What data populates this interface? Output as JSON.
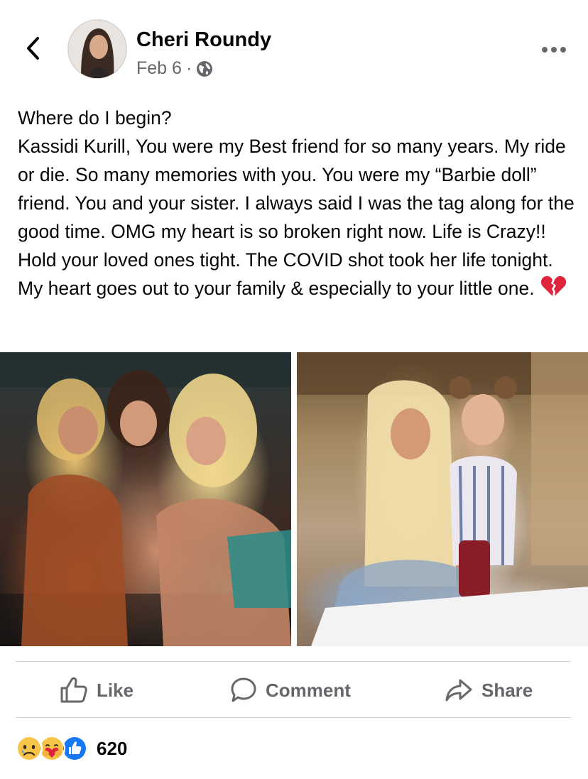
{
  "header": {
    "author_name": "Cheri Roundy",
    "date": "Feb 6",
    "separator": "·",
    "audience_icon": "globe-icon",
    "back_icon": "chevron-left-icon",
    "more_icon": "more-horizontal-icon"
  },
  "post": {
    "lines": [
      "Where do I begin?",
      "Kassidi Kurill, You were my Best friend for so many years. My ride or die. So many memories with you. You were my “Barbie doll” friend. You and your sister. I always said I was the tag along for the good time. OMG my heart is so broken right now. Life is Crazy!! Hold your loved ones tight. The COVID shot took her life tonight. My heart goes out to your family & especially to your little one."
    ],
    "trailing_emoji": "broken-heart-icon"
  },
  "actions": {
    "like_label": "Like",
    "comment_label": "Comment",
    "share_label": "Share"
  },
  "reactions": {
    "icons": [
      "sad-reaction-icon",
      "care-reaction-icon",
      "like-reaction-icon"
    ],
    "count": "620"
  },
  "colors": {
    "text_primary": "#050505",
    "text_secondary": "#65676b",
    "divider": "#ced0d4",
    "like_blue": "#1877f2",
    "reaction_yellow": "#f7c44a",
    "broken_heart_red": "#e0243b"
  }
}
